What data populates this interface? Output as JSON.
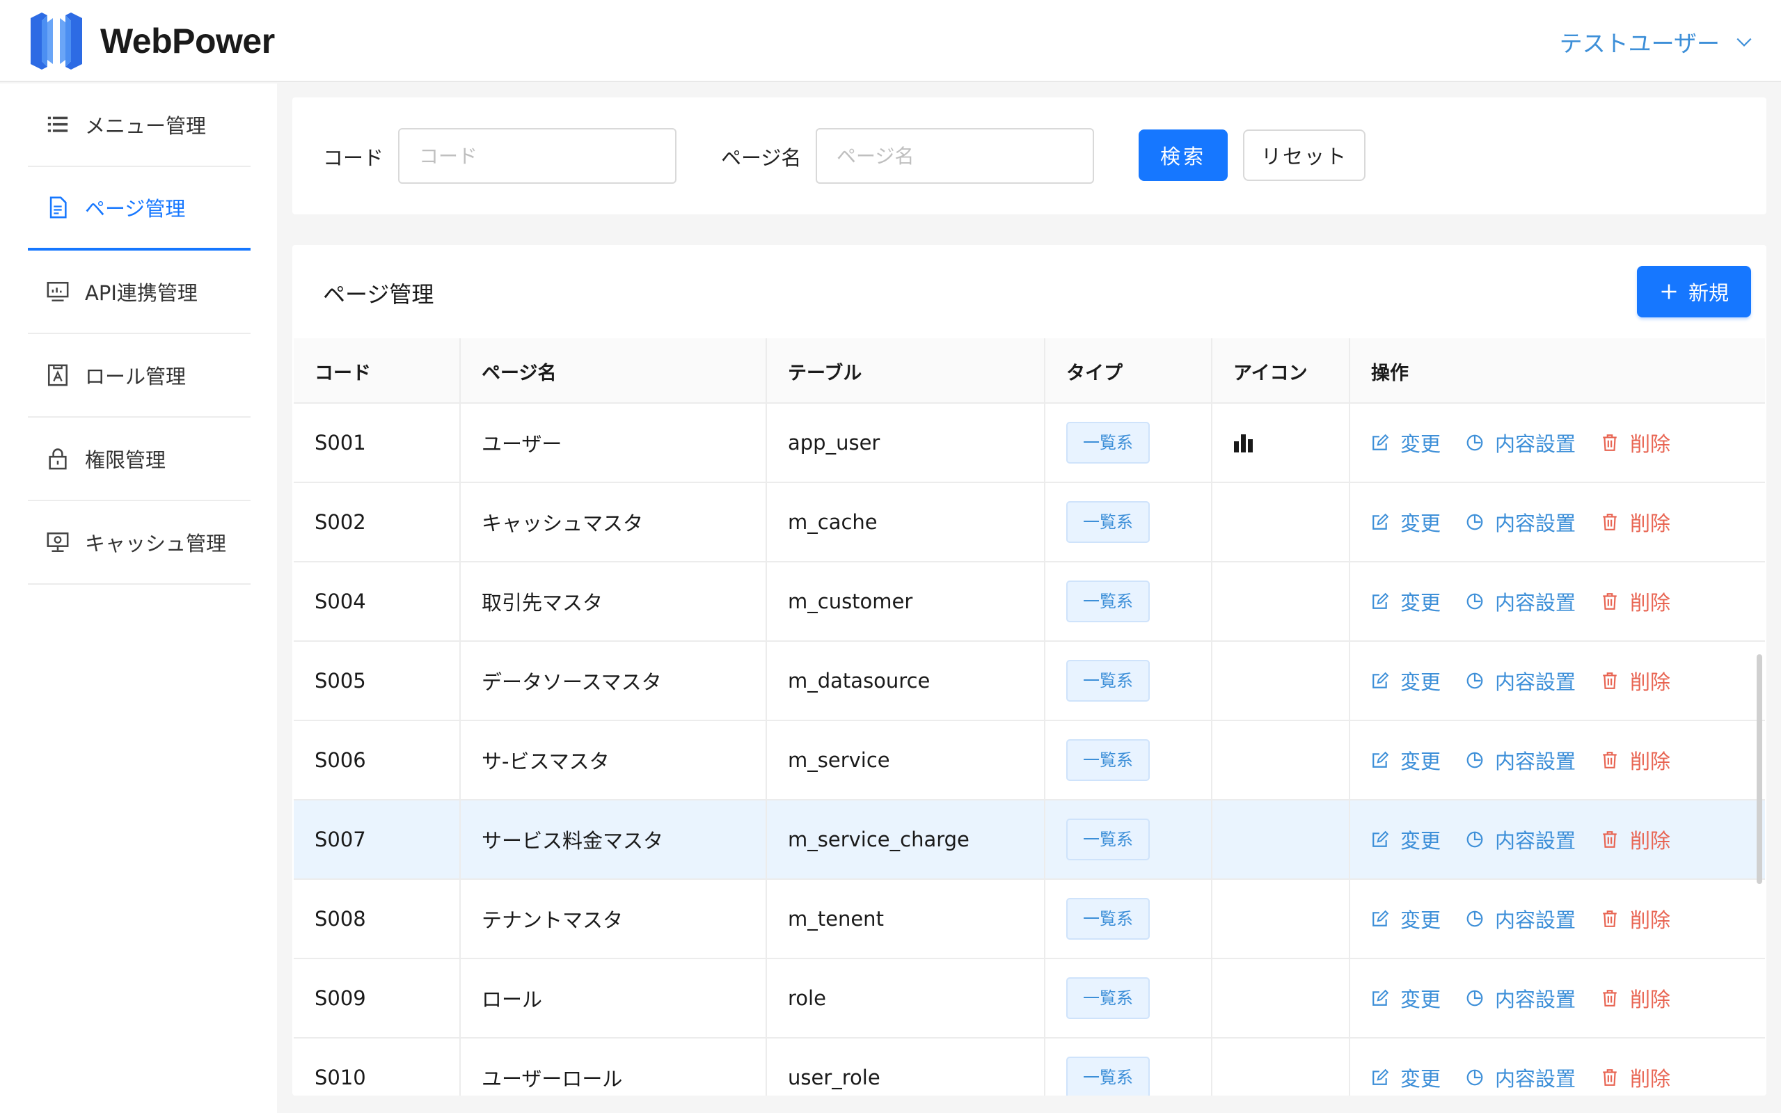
{
  "app": {
    "name": "WebPower"
  },
  "header": {
    "user_name": "テストユーザー"
  },
  "sidebar": {
    "items": [
      {
        "label": "メニュー管理",
        "icon": "list-icon",
        "active": false
      },
      {
        "label": "ページ管理",
        "icon": "document-icon",
        "active": true
      },
      {
        "label": "API連携管理",
        "icon": "monitor-icon",
        "active": false
      },
      {
        "label": "ロール管理",
        "icon": "user-badge-icon",
        "active": false
      },
      {
        "label": "権限管理",
        "icon": "lock-icon",
        "active": false
      },
      {
        "label": "キャッシュ管理",
        "icon": "desktop-icon",
        "active": false
      }
    ]
  },
  "search": {
    "code_label": "コード",
    "code_placeholder": "コード",
    "code_value": "",
    "page_name_label": "ページ名",
    "page_name_placeholder": "ページ名",
    "page_name_value": "",
    "search_button": "検索",
    "reset_button": "リセット"
  },
  "table_card": {
    "title": "ページ管理",
    "new_button": "新規",
    "columns": [
      "コード",
      "ページ名",
      "テーブル",
      "タイプ",
      "アイコン",
      "操作"
    ],
    "rows": [
      {
        "code": "S001",
        "page_name": "ユーザー",
        "table": "app_user",
        "type": "一覧系",
        "icon": "bar-chart-icon"
      },
      {
        "code": "S002",
        "page_name": "キャッシュマスタ",
        "table": "m_cache",
        "type": "一覧系",
        "icon": ""
      },
      {
        "code": "S004",
        "page_name": "取引先マスタ",
        "table": "m_customer",
        "type": "一覧系",
        "icon": ""
      },
      {
        "code": "S005",
        "page_name": "データソースマスタ",
        "table": "m_datasource",
        "type": "一覧系",
        "icon": ""
      },
      {
        "code": "S006",
        "page_name": "サ-ビスマスタ",
        "table": "m_service",
        "type": "一覧系",
        "icon": ""
      },
      {
        "code": "S007",
        "page_name": "サービス料金マスタ",
        "table": "m_service_charge",
        "type": "一覧系",
        "icon": "",
        "highlighted": true
      },
      {
        "code": "S008",
        "page_name": "テナントマスタ",
        "table": "m_tenent",
        "type": "一覧系",
        "icon": ""
      },
      {
        "code": "S009",
        "page_name": "ロール",
        "table": "role",
        "type": "一覧系",
        "icon": ""
      },
      {
        "code": "S010",
        "page_name": "ユーザーロール",
        "table": "user_role",
        "type": "一覧系",
        "icon": ""
      }
    ],
    "actions": {
      "edit": "変更",
      "content": "内容設置",
      "delete": "削除"
    }
  },
  "colors": {
    "primary": "#1677ff",
    "link": "#3d8fd8",
    "danger": "#e86452",
    "highlight_row": "#eaf4fe"
  }
}
